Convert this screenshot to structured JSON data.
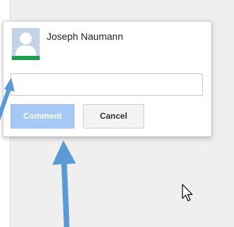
{
  "comment_box": {
    "author_name": "Joseph Naumann",
    "input_value": "",
    "input_placeholder": "",
    "comment_label": "Comment",
    "cancel_label": "Cancel",
    "avatar_icon": "default-user-avatar-icon",
    "comment_button_color": "#a6c8f5",
    "avatar_bar_color": "#1f9e4f"
  },
  "annotations": {
    "arrow_color": "#5b9bd5",
    "cursor_icon": "mouse-pointer-icon"
  }
}
